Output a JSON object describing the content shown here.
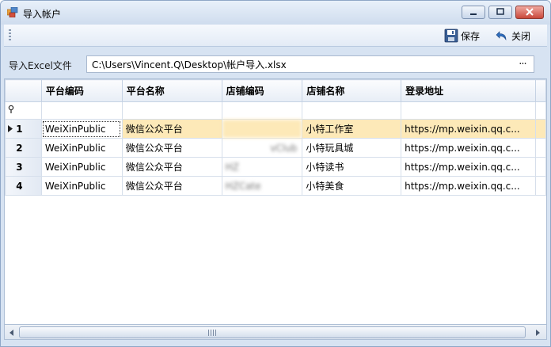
{
  "window": {
    "title": "导入帐户"
  },
  "toolbar": {
    "save_label": "保存",
    "close_label": "关闭"
  },
  "file": {
    "label": "导入Excel文件",
    "path": "C:\\Users\\Vincent.Q\\Desktop\\帐户导入.xlsx",
    "browse": "···"
  },
  "grid": {
    "columns": [
      "平台编码",
      "平台名称",
      "店铺编码",
      "店铺名称",
      "登录地址"
    ],
    "rows": [
      {
        "num": "1",
        "cells": [
          "WeiXinPublic",
          "微信公众平台",
          "",
          "小特工作室",
          "https://mp.weixin.qq.c..."
        ]
      },
      {
        "num": "2",
        "cells": [
          "WeiXinPublic",
          "微信公众平台",
          "vClub",
          "小特玩具城",
          "https://mp.weixin.qq.c..."
        ]
      },
      {
        "num": "3",
        "cells": [
          "WeiXinPublic",
          "微信公众平台",
          "HZ",
          "小特读书",
          "https://mp.weixin.qq.c..."
        ]
      },
      {
        "num": "4",
        "cells": [
          "WeiXinPublic",
          "微信公众平台",
          "HZCate",
          "小特美食",
          "https://mp.weixin.qq.c..."
        ]
      }
    ],
    "selected_row": 1
  },
  "colors": {
    "selected_row": "#fde9b8",
    "titlebar": "#d7e3f2"
  }
}
